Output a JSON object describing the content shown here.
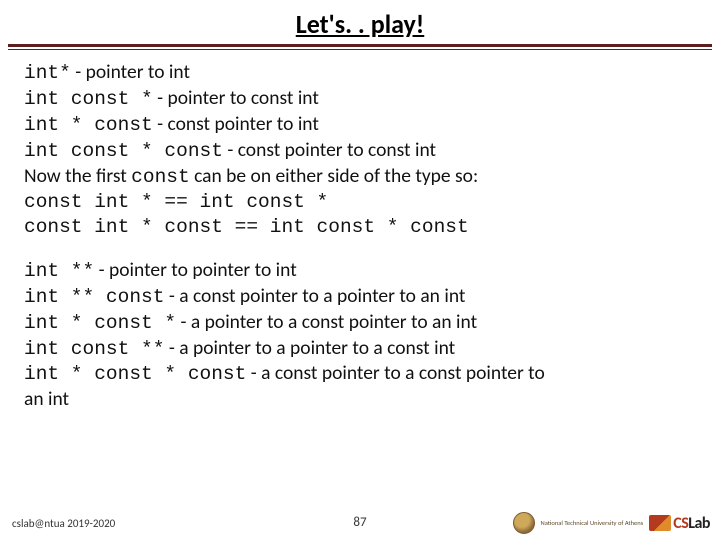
{
  "title": "Let's. . play!",
  "block1": {
    "l1_code": "int*",
    "l1_desc": " - pointer to int",
    "l2_code": "int const *",
    "l2_desc": " - pointer to const int",
    "l3_code": "int * const",
    "l3_desc": " - const pointer to int",
    "l4_code": "int const * const",
    "l4_desc": " - const pointer to const int",
    "l5a": "Now the first ",
    "l5b": "const",
    "l5c": " can be on either side of the type so:",
    "l6": "const int * == int const *",
    "l7": "const int * const == int const * const"
  },
  "block2": {
    "l1_code": "int **",
    "l1_desc": " - pointer to pointer to int",
    "l2_code": "int ** const",
    "l2_desc": " - a const pointer to a pointer to an int",
    "l3_code": "int * const *",
    "l3_desc": " - a pointer to a const pointer to an int",
    "l4_code": "int const **",
    "l4_desc": " - a pointer to a pointer to a const int",
    "l5_code": "int * const * const",
    "l5_desc": " - a const pointer to a const pointer to",
    "l6": "an int"
  },
  "footer": {
    "left": "cslab@ntua 2019-2020",
    "page": "87",
    "ntua_line1": "National Technical University of Athens",
    "cslab": "CSLab",
    "cs": "CS",
    "lab": "Lab"
  }
}
